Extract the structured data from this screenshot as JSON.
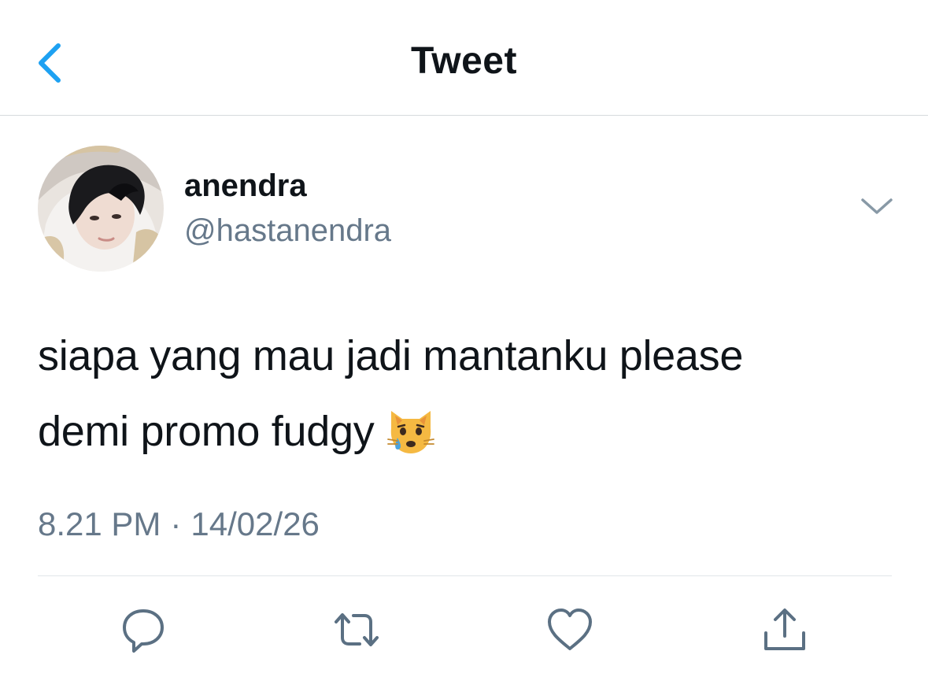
{
  "header": {
    "title": "Tweet",
    "back_icon": "chevron-left-icon"
  },
  "tweet": {
    "author": {
      "display_name": "anendra",
      "handle": "@hastanendra",
      "avatar": "profile-photo"
    },
    "text_lines": [
      "siapa yang mau jadi mantanku please",
      "demi promo fudgy"
    ],
    "emoji": "crying-cat-face-emoji",
    "time": "8.21 PM",
    "separator": "·",
    "date": "14/02/26",
    "more_icon": "chevron-down-icon"
  },
  "actions": [
    {
      "name": "reply",
      "icon": "reply-icon"
    },
    {
      "name": "retweet",
      "icon": "retweet-icon"
    },
    {
      "name": "like",
      "icon": "heart-icon"
    },
    {
      "name": "share",
      "icon": "share-icon"
    }
  ],
  "colors": {
    "accent": "#1da1f2",
    "text_primary": "#0f1419",
    "text_secondary": "#66788a",
    "divider": "#e1e6ea"
  }
}
